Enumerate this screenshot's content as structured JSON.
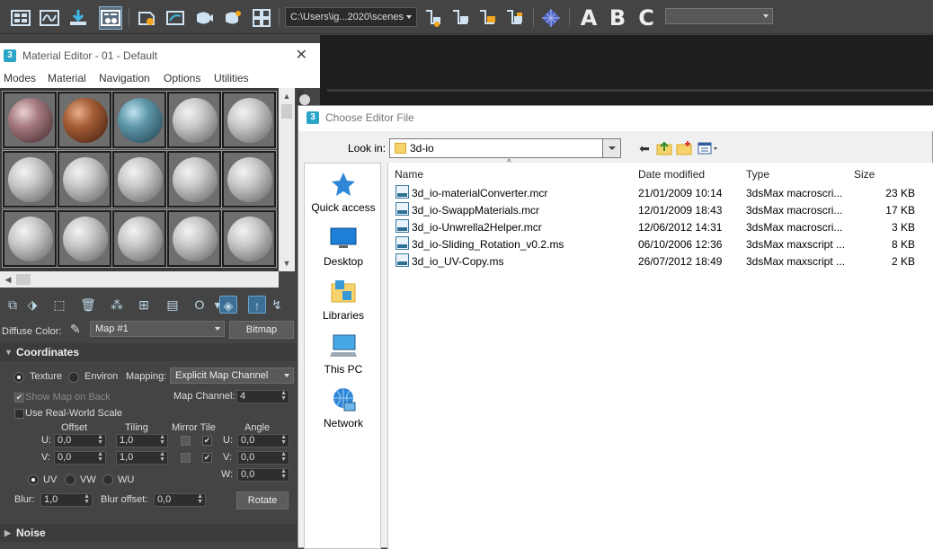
{
  "toolbar": {
    "path": "C:\\Users\\ig...2020\\scenes",
    "letters": [
      "A",
      "B",
      "C"
    ]
  },
  "material_editor": {
    "title": "Material Editor - 01 - Default",
    "menu": [
      "Modes",
      "Material",
      "Navigation",
      "Options",
      "Utilities"
    ],
    "diffuse_label": "Diffuse Color:",
    "map_name": "Map #1",
    "map_type": "Bitmap",
    "coordinates": {
      "header": "Coordinates",
      "texture_label": "Texture",
      "environ_label": "Environ",
      "mapping_label": "Mapping:",
      "mapping_value": "Explicit Map Channel",
      "show_map_label": "Show Map on Back",
      "map_channel_label": "Map Channel:",
      "map_channel_value": "4",
      "real_world_label": "Use Real-World Scale",
      "offset_label": "Offset",
      "tiling_label": "Tiling",
      "mirror_tile_label": "Mirror Tile",
      "angle_label": "Angle",
      "u_label": "U:",
      "v_label": "V:",
      "w_label": "W:",
      "offset_u": "0,0",
      "offset_v": "0,0",
      "tiling_u": "1,0",
      "tiling_v": "1,0",
      "angle_u": "0,0",
      "angle_v": "0,0",
      "angle_w": "0,0",
      "uv_label": "UV",
      "vw_label": "VW",
      "wu_label": "WU",
      "blur_label": "Blur:",
      "blur_value": "1,0",
      "blur_offset_label": "Blur offset:",
      "blur_offset_value": "0,0",
      "rotate_label": "Rotate"
    },
    "noise_header": "Noise"
  },
  "dialog": {
    "title": "Choose Editor File",
    "look_in_label": "Look in:",
    "look_in_value": "3d-io",
    "places": [
      "Quick access",
      "Desktop",
      "Libraries",
      "This PC",
      "Network"
    ],
    "columns": [
      "Name",
      "Date modified",
      "Type",
      "Size"
    ],
    "files": [
      {
        "name": "3d_io-materialConverter.mcr",
        "date": "21/01/2009 10:14",
        "type": "3dsMax macroscri...",
        "size": "23 KB",
        "ext": "MCR"
      },
      {
        "name": "3d_io-SwappMaterials.mcr",
        "date": "12/01/2009 18:43",
        "type": "3dsMax macroscri...",
        "size": "17 KB",
        "ext": "MCR"
      },
      {
        "name": "3d_io-Unwrella2Helper.mcr",
        "date": "12/06/2012 14:31",
        "type": "3dsMax macroscri...",
        "size": "3 KB",
        "ext": "MCR"
      },
      {
        "name": "3d_io-Sliding_Rotation_v0.2.ms",
        "date": "06/10/2006 12:36",
        "type": "3dsMax maxscript ...",
        "size": "8 KB",
        "ext": "MS"
      },
      {
        "name": "3d_io_UV-Copy.ms",
        "date": "26/07/2012 18:49",
        "type": "3dsMax maxscript ...",
        "size": "2 KB",
        "ext": "MS"
      }
    ]
  }
}
